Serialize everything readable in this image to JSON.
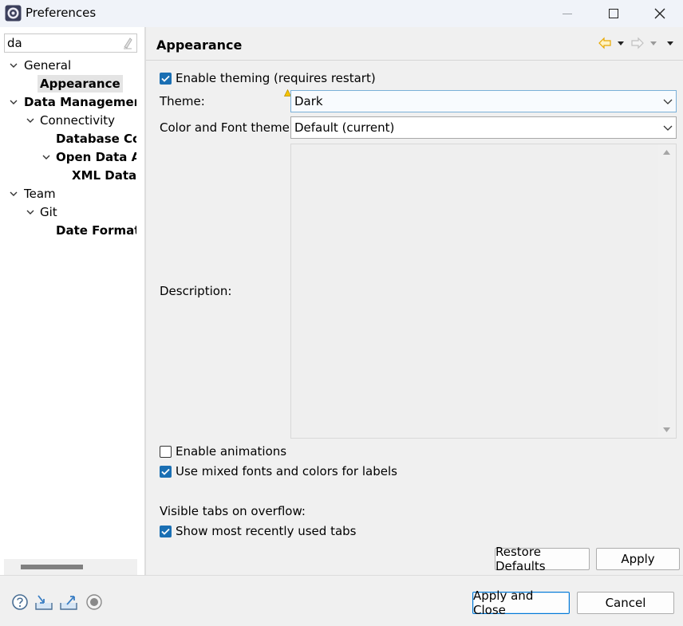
{
  "window": {
    "title": "Preferences",
    "icon": "eclipse-icon"
  },
  "filter": {
    "value": "da"
  },
  "tree": {
    "items": [
      {
        "label": "General"
      },
      {
        "label": "Appearance"
      },
      {
        "label": "Data Management"
      },
      {
        "label": "Connectivity"
      },
      {
        "label": "Database Conn"
      },
      {
        "label": "Open Data Acc"
      },
      {
        "label": "XML Data S"
      },
      {
        "label": "Team"
      },
      {
        "label": "Git"
      },
      {
        "label": "Date Format"
      }
    ]
  },
  "page": {
    "title": "Appearance",
    "enable_theming": {
      "label": "Enable theming (requires restart)",
      "checked": true
    },
    "theme": {
      "label": "Theme:",
      "value": "Dark"
    },
    "color_font_theme": {
      "label": "Color and Font theme:",
      "value": "Default (current)"
    },
    "description": {
      "label": "Description:"
    },
    "enable_animations": {
      "label": "Enable animations",
      "checked": false
    },
    "mixed_fonts": {
      "label": "Use mixed fonts and colors for labels",
      "checked": true
    },
    "visible_tabs": {
      "label": "Visible tabs on overflow:"
    },
    "show_recent_tabs": {
      "label": "Show most recently used tabs",
      "checked": true
    },
    "restore_defaults": "Restore Defaults",
    "apply": "Apply"
  },
  "footer": {
    "apply_close": "Apply and Close",
    "cancel": "Cancel",
    "icons": [
      "help-icon",
      "import-icon",
      "export-icon",
      "record-icon"
    ]
  },
  "colors": {
    "accent": "#1a6fb3",
    "panel": "#f0f0f0",
    "nav_back": "#e8a800"
  }
}
